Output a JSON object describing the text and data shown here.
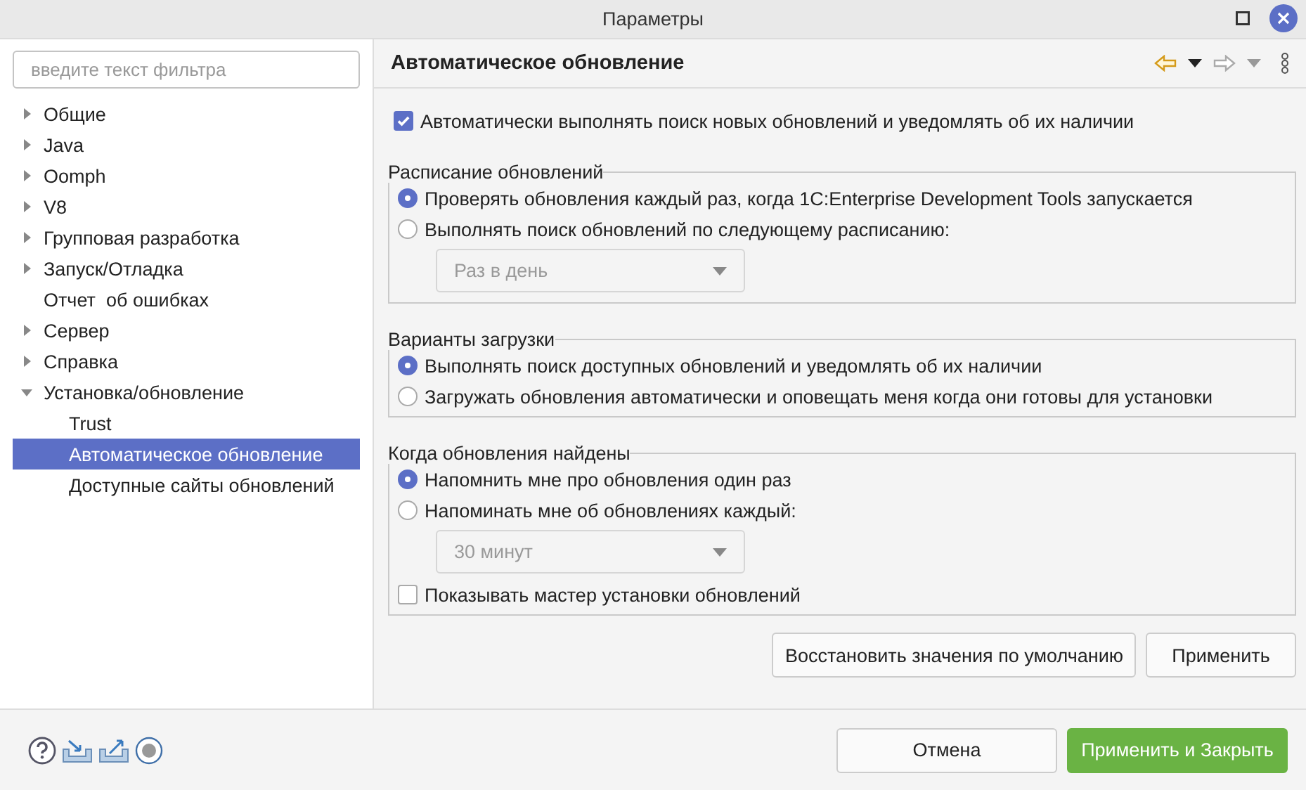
{
  "window": {
    "title": "Параметры"
  },
  "sidebar": {
    "filter": {
      "placeholder": "введите текст фильтра"
    },
    "tree": [
      {
        "label": "Общие",
        "kind": "folder",
        "expanded": false,
        "selected": false
      },
      {
        "label": "Java",
        "kind": "folder",
        "expanded": false,
        "selected": false
      },
      {
        "label": "Oomph",
        "kind": "folder",
        "expanded": false,
        "selected": false
      },
      {
        "label": "V8",
        "kind": "folder",
        "expanded": false,
        "selected": false
      },
      {
        "label": "Групповая разработка",
        "kind": "folder",
        "expanded": false,
        "selected": false
      },
      {
        "label": "Запуск/Отладка",
        "kind": "folder",
        "expanded": false,
        "selected": false
      },
      {
        "label": "Отчет  об ошибках",
        "kind": "page",
        "selected": false
      },
      {
        "label": "Сервер",
        "kind": "folder",
        "expanded": false,
        "selected": false
      },
      {
        "label": "Справка",
        "kind": "folder",
        "expanded": false,
        "selected": false
      },
      {
        "label": "Установка/обновление",
        "kind": "folder",
        "expanded": true,
        "selected": false,
        "children": [
          {
            "label": "Trust",
            "kind": "page",
            "selected": false
          },
          {
            "label": "Автоматическое обновление",
            "kind": "page",
            "selected": true
          },
          {
            "label": "Доступные сайты обновлений",
            "kind": "page",
            "selected": false
          }
        ]
      }
    ]
  },
  "page": {
    "title": "Автоматическое обновление",
    "auto_check": {
      "label": "Автоматически выполнять поиск новых обновлений и уведомлять об их наличии",
      "checked": true
    },
    "groups": [
      {
        "title": "Расписание обновлений",
        "options": [
          {
            "kind": "radio",
            "label": "Проверять обновления каждый раз, когда 1C:Enterprise Development Tools запускается",
            "selected": true
          },
          {
            "kind": "radio",
            "label": "Выполнять поиск обновлений по следующему расписанию:",
            "selected": false
          },
          {
            "kind": "select",
            "value": "Раз в день",
            "disabled": true
          }
        ]
      },
      {
        "title": "Варианты загрузки",
        "options": [
          {
            "kind": "radio",
            "label": "Выполнять поиск доступных обновлений и уведомлять об их наличии",
            "selected": true
          },
          {
            "kind": "radio",
            "label": "Загружать обновления автоматически и оповещать меня когда они готовы для установки",
            "selected": false
          }
        ]
      },
      {
        "title": "Когда обновления найдены",
        "options": [
          {
            "kind": "radio",
            "label": "Напомнить мне про обновления один раз",
            "selected": true
          },
          {
            "kind": "radio",
            "label": "Напоминать мне об обновлениях каждый:",
            "selected": false
          },
          {
            "kind": "select",
            "value": "30 минут",
            "disabled": true
          },
          {
            "kind": "checkbox",
            "label": "Показывать мастер установки обновлений",
            "checked": false
          }
        ]
      }
    ],
    "buttons": [
      {
        "label": "Восстановить значения по умолчанию"
      },
      {
        "label": "Применить"
      }
    ]
  },
  "footer": {
    "buttons": [
      {
        "label": "Отмена",
        "kind": "normal"
      },
      {
        "label": "Применить и Закрыть",
        "kind": "primary"
      }
    ]
  }
}
